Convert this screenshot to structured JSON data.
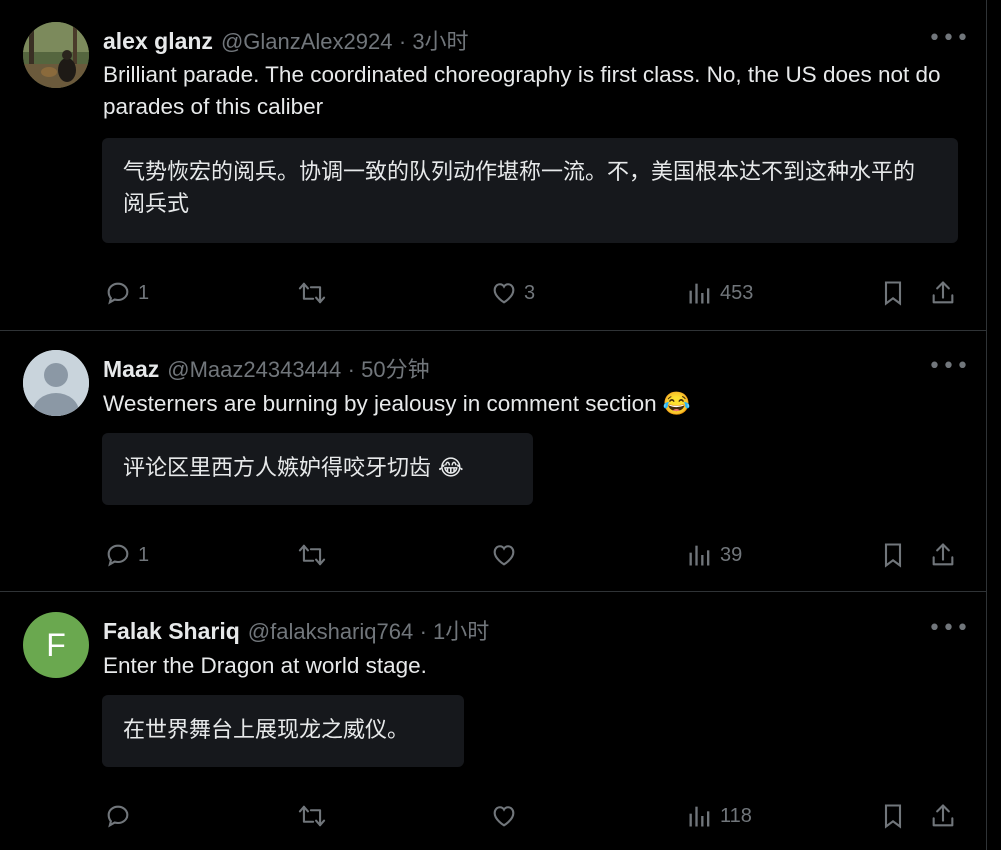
{
  "posts": [
    {
      "name": "alex glanz",
      "handle": "@GlanzAlex2924",
      "time": "· 3小时",
      "text": "Brilliant parade.  The coordinated choreography is first class.  No, the US does not do parades of this caliber",
      "translation": "气势恢宏的阅兵。协调一致的队列动作堪称一流。不，美国根本达不到这种水平的阅兵式",
      "replies": "1",
      "retweets": "",
      "likes": "3",
      "views": "453"
    },
    {
      "name": "Maaz",
      "handle": "@Maaz24343444",
      "time": "· 50分钟",
      "text": "Westerners are burning by jealousy in comment section 😂",
      "translation": "评论区里西方人嫉妒得咬牙切齿 😂",
      "replies": "1",
      "retweets": "",
      "likes": "",
      "views": "39"
    },
    {
      "name": "Falak Shariq",
      "handle": "@falakshariq764",
      "time": "· 1小时",
      "avatar_letter": "F",
      "text": "Enter the Dragon at world stage.",
      "translation": "在世界舞台上展现龙之威仪。",
      "replies": "",
      "retweets": "",
      "likes": "",
      "views": "118"
    }
  ],
  "more_label": "•••",
  "colors": {
    "bg": "#000000",
    "text": "#e7e9ea",
    "muted": "#71767b",
    "panel": "#16181c",
    "border": "#2f3336",
    "avatar_green": "#6aa84f"
  },
  "icons": [
    "reply-icon",
    "retweet-icon",
    "like-icon",
    "views-icon",
    "bookmark-icon",
    "share-icon",
    "more-icon"
  ]
}
